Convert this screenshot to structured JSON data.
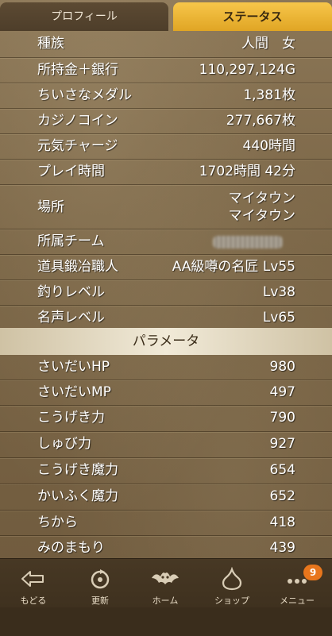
{
  "tabs": {
    "profile": "プロフィール",
    "status": "ステータス"
  },
  "rows": [
    {
      "k": "種族",
      "v": "人間　女"
    },
    {
      "k": "所持金＋銀行",
      "v": "110,297,124G"
    },
    {
      "k": "ちいさなメダル",
      "v": "1,381枚"
    },
    {
      "k": "カジノコイン",
      "v": "277,667枚"
    },
    {
      "k": "元気チャージ",
      "v": "440時間"
    },
    {
      "k": "プレイ時間",
      "v": "1702時間 42分"
    },
    {
      "k": "場所",
      "v1": "マイタウン",
      "v2": "マイタウン"
    },
    {
      "k": "所属チーム",
      "v": ""
    },
    {
      "k": "道具鍛冶職人",
      "v": "AA級噂の名匠 Lv55"
    },
    {
      "k": "釣りレベル",
      "v": "Lv38"
    },
    {
      "k": "名声レベル",
      "v": "Lv65"
    }
  ],
  "section_title": "パラメータ",
  "params": [
    {
      "k": "さいだいHP",
      "v": "980"
    },
    {
      "k": "さいだいMP",
      "v": "497"
    },
    {
      "k": "こうげき力",
      "v": "790"
    },
    {
      "k": "しゅび力",
      "v": "927"
    },
    {
      "k": "こうげき魔力",
      "v": "654"
    },
    {
      "k": "かいふく魔力",
      "v": "652"
    },
    {
      "k": "ちから",
      "v": "418"
    },
    {
      "k": "みのまもり",
      "v": "439"
    }
  ],
  "nav": {
    "back": "もどる",
    "refresh": "更新",
    "home": "ホーム",
    "shop": "ショップ",
    "menu": "メニュー",
    "menu_badge": "9"
  },
  "colors": {
    "tab_active": "#f1b93a",
    "badge": "#e8761c"
  }
}
